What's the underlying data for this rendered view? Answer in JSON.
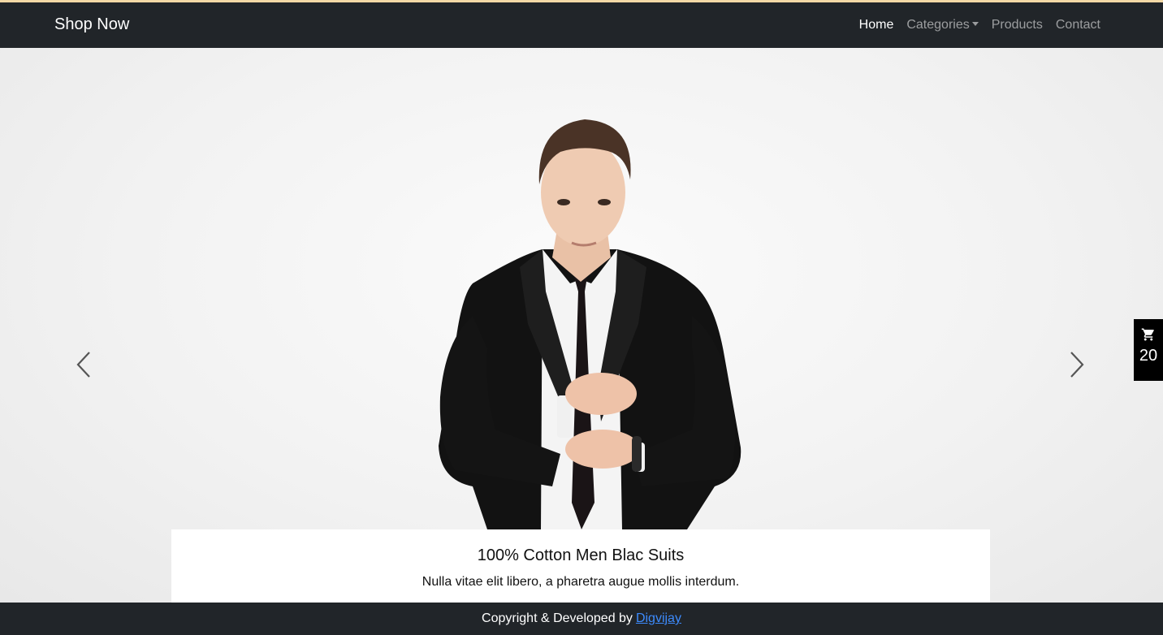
{
  "navbar": {
    "brand": "Shop Now",
    "links": [
      {
        "label": "Home",
        "active": true
      },
      {
        "label": "Categories",
        "dropdown": true
      },
      {
        "label": "Products"
      },
      {
        "label": "Contact"
      }
    ]
  },
  "carousel": {
    "prev_icon": "chevron-left-icon",
    "next_icon": "chevron-right-icon",
    "caption": {
      "title": "100% Cotton Men Blac Suits",
      "text": "Nulla vitae elit libero, a pharetra augue mollis interdum."
    }
  },
  "cart": {
    "icon": "cart-icon",
    "count": "20"
  },
  "footer": {
    "text": "Copyright & Developed by",
    "link_label": "Digvijay",
    "link_color": "#3d8bfd"
  },
  "colors": {
    "navbar_bg": "#212529",
    "accent_strip": "#f3d8a6",
    "cart_bg": "#000000"
  }
}
